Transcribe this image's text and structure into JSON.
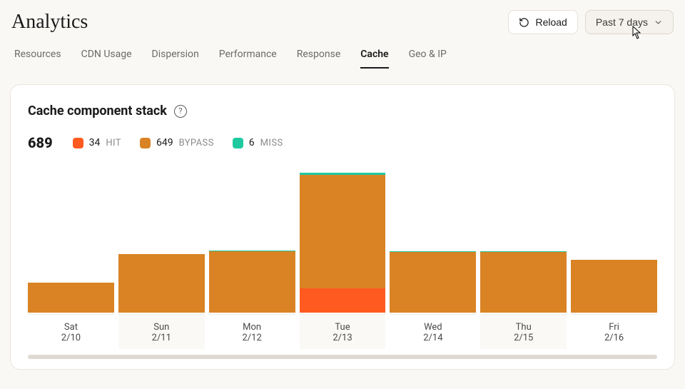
{
  "header": {
    "title": "Analytics",
    "reload_label": "Reload",
    "range_label": "Past 7 days"
  },
  "tabs": [
    {
      "id": "resources",
      "label": "Resources",
      "active": false
    },
    {
      "id": "cdn",
      "label": "CDN Usage",
      "active": false
    },
    {
      "id": "dispersion",
      "label": "Dispersion",
      "active": false
    },
    {
      "id": "performance",
      "label": "Performance",
      "active": false
    },
    {
      "id": "response",
      "label": "Response",
      "active": false
    },
    {
      "id": "cache",
      "label": "Cache",
      "active": true
    },
    {
      "id": "geo",
      "label": "Geo & IP",
      "active": false
    }
  ],
  "card": {
    "title": "Cache component stack",
    "total": "689",
    "legend": [
      {
        "key": "hit",
        "count": "34",
        "label": "HIT",
        "color": "#ff5a1f"
      },
      {
        "key": "bypass",
        "count": "649",
        "label": "BYPASS",
        "color": "#d98324"
      },
      {
        "key": "miss",
        "count": "6",
        "label": "MISS",
        "color": "#1fc9a0"
      }
    ]
  },
  "chart_data": {
    "type": "bar",
    "stacked": true,
    "title": "Cache component stack",
    "xlabel": "",
    "ylabel": "",
    "ylim": [
      0,
      200
    ],
    "categories": [
      "Sat",
      "Sun",
      "Mon",
      "Tue",
      "Wed",
      "Thu",
      "Fri"
    ],
    "category_dates": [
      "2/10",
      "2/11",
      "2/12",
      "2/13",
      "2/14",
      "2/15",
      "2/16"
    ],
    "series": [
      {
        "name": "HIT",
        "color": "#ff5a1f",
        "values": [
          0,
          0,
          0,
          34,
          0,
          0,
          0
        ]
      },
      {
        "name": "BYPASS",
        "color": "#d98324",
        "values": [
          42,
          82,
          86,
          159,
          85,
          85,
          74
        ]
      },
      {
        "name": "MISS",
        "color": "#1fc9a0",
        "values": [
          0,
          0,
          1,
          3,
          1,
          1,
          0
        ]
      }
    ]
  }
}
